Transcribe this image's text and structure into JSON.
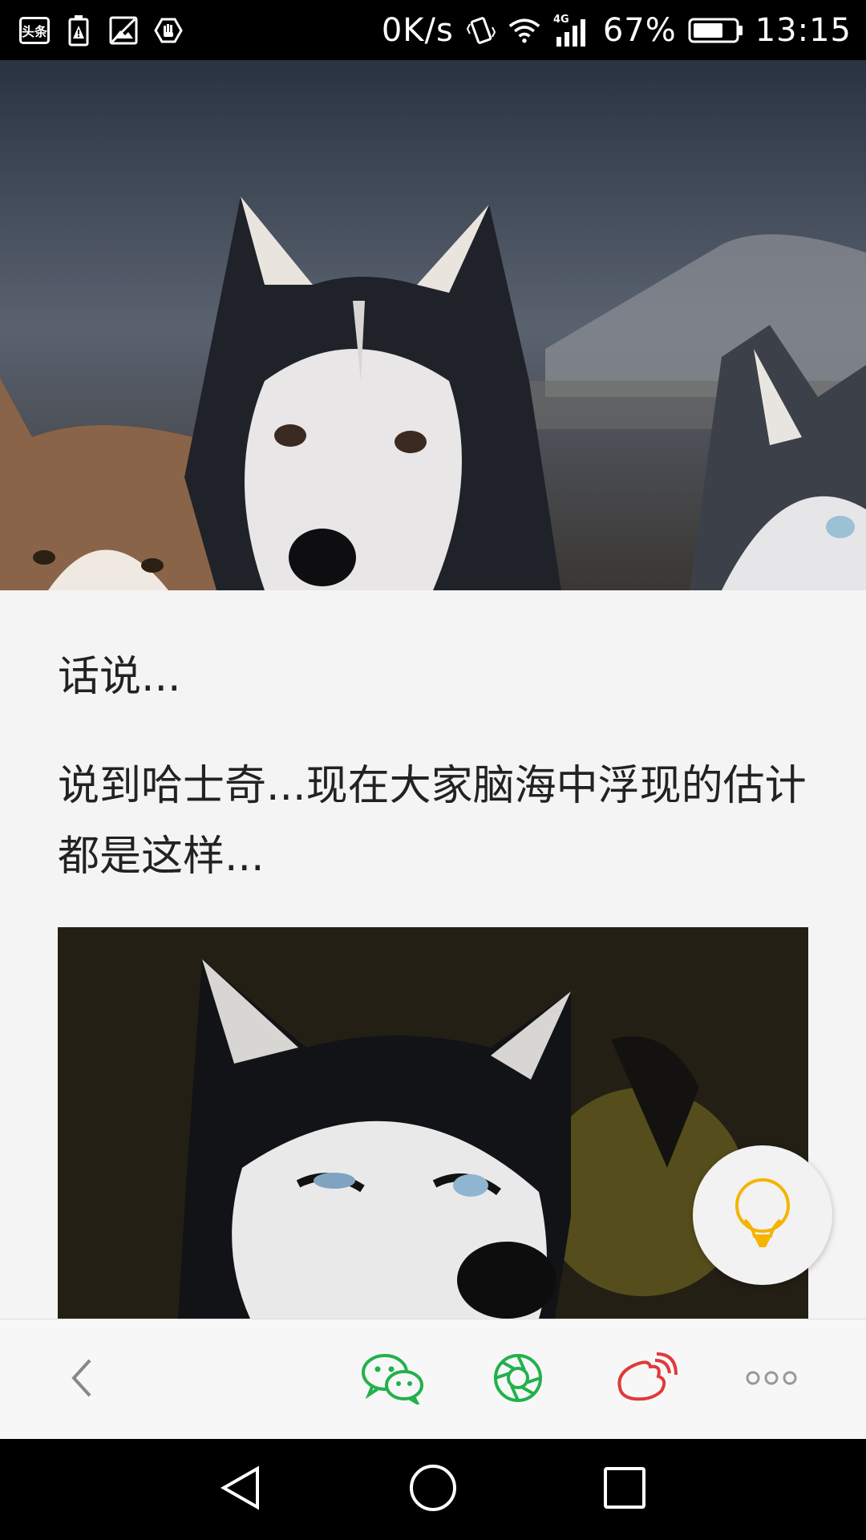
{
  "status_bar": {
    "app_badge": "头条",
    "network_speed": "0K/s",
    "network_type": "4G",
    "battery_percent": "67%",
    "time": "13:15",
    "icons": [
      "toutiao-icon",
      "battery-warning-icon",
      "image-icon",
      "hand-icon",
      "vibrate-icon",
      "wifi-icon",
      "signal-icon",
      "battery-icon"
    ]
  },
  "article": {
    "para1": "话说...",
    "para2": "说到哈士奇...现在大家脑海中浮现的估计都是这样..."
  },
  "fab": {
    "icon": "lightbulb-icon",
    "color": "#f5b400"
  },
  "toolbar": {
    "items": [
      "back-icon",
      "wechat-icon",
      "moments-icon",
      "weibo-icon",
      "more-icon"
    ],
    "colors": {
      "wechat": "#22b14c",
      "moments": "#22b14c",
      "weibo": "#e03a3a",
      "neutral": "#888888"
    }
  },
  "navbar": {
    "items": [
      "nav-back-icon",
      "nav-home-icon",
      "nav-recents-icon"
    ]
  }
}
